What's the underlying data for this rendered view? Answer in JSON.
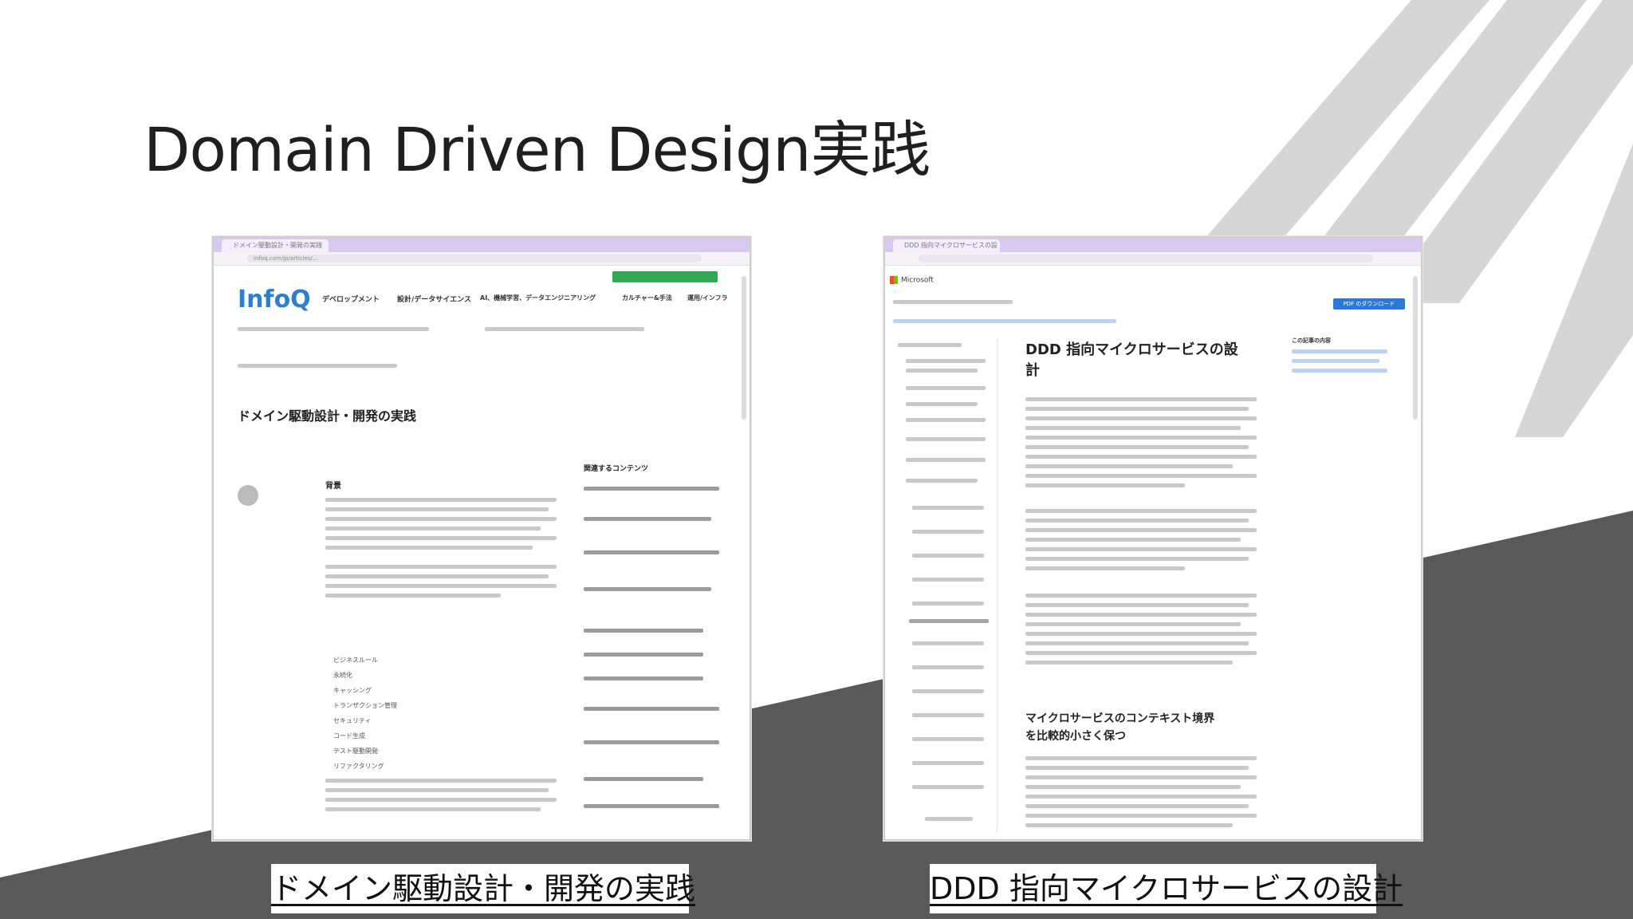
{
  "slide": {
    "title": "Domain Driven Design実践"
  },
  "left_screenshot": {
    "tab_title": "ドメイン駆動設計・開発の実践",
    "url": "infoq.com/jp/articles/...",
    "logo": "InfoQ",
    "nav": [
      "デベロップメント",
      "設計/データサイエンス",
      "AI、機械学習、データエンジニアリング",
      "カルチャー&手法",
      "運用/インフラ"
    ],
    "article_title": "ドメイン駆動設計・開発の実践",
    "section_heading": "背景",
    "related_heading": "関連するコンテンツ",
    "bullets": [
      "ビジネスルール",
      "永続化",
      "キャッシング",
      "トランザクション管理",
      "セキュリティ",
      "コード生成",
      "テスト駆動開発",
      "リファクタリング"
    ]
  },
  "right_screenshot": {
    "brand": "Microsoft",
    "article_title_line1": "DDD 指向マイクロサービスの設",
    "article_title_line2": "計",
    "section_heading_line1": "マイクロサービスのコンテキスト境界",
    "section_heading_line2": "を比較的小さく保つ",
    "download_button": "PDF のダウンロード",
    "toc_title": "この記事の内容"
  },
  "captions": {
    "left": "ドメイン駆動設計・開発の実践",
    "right": "DDD 指向マイクロサービスの設計"
  }
}
